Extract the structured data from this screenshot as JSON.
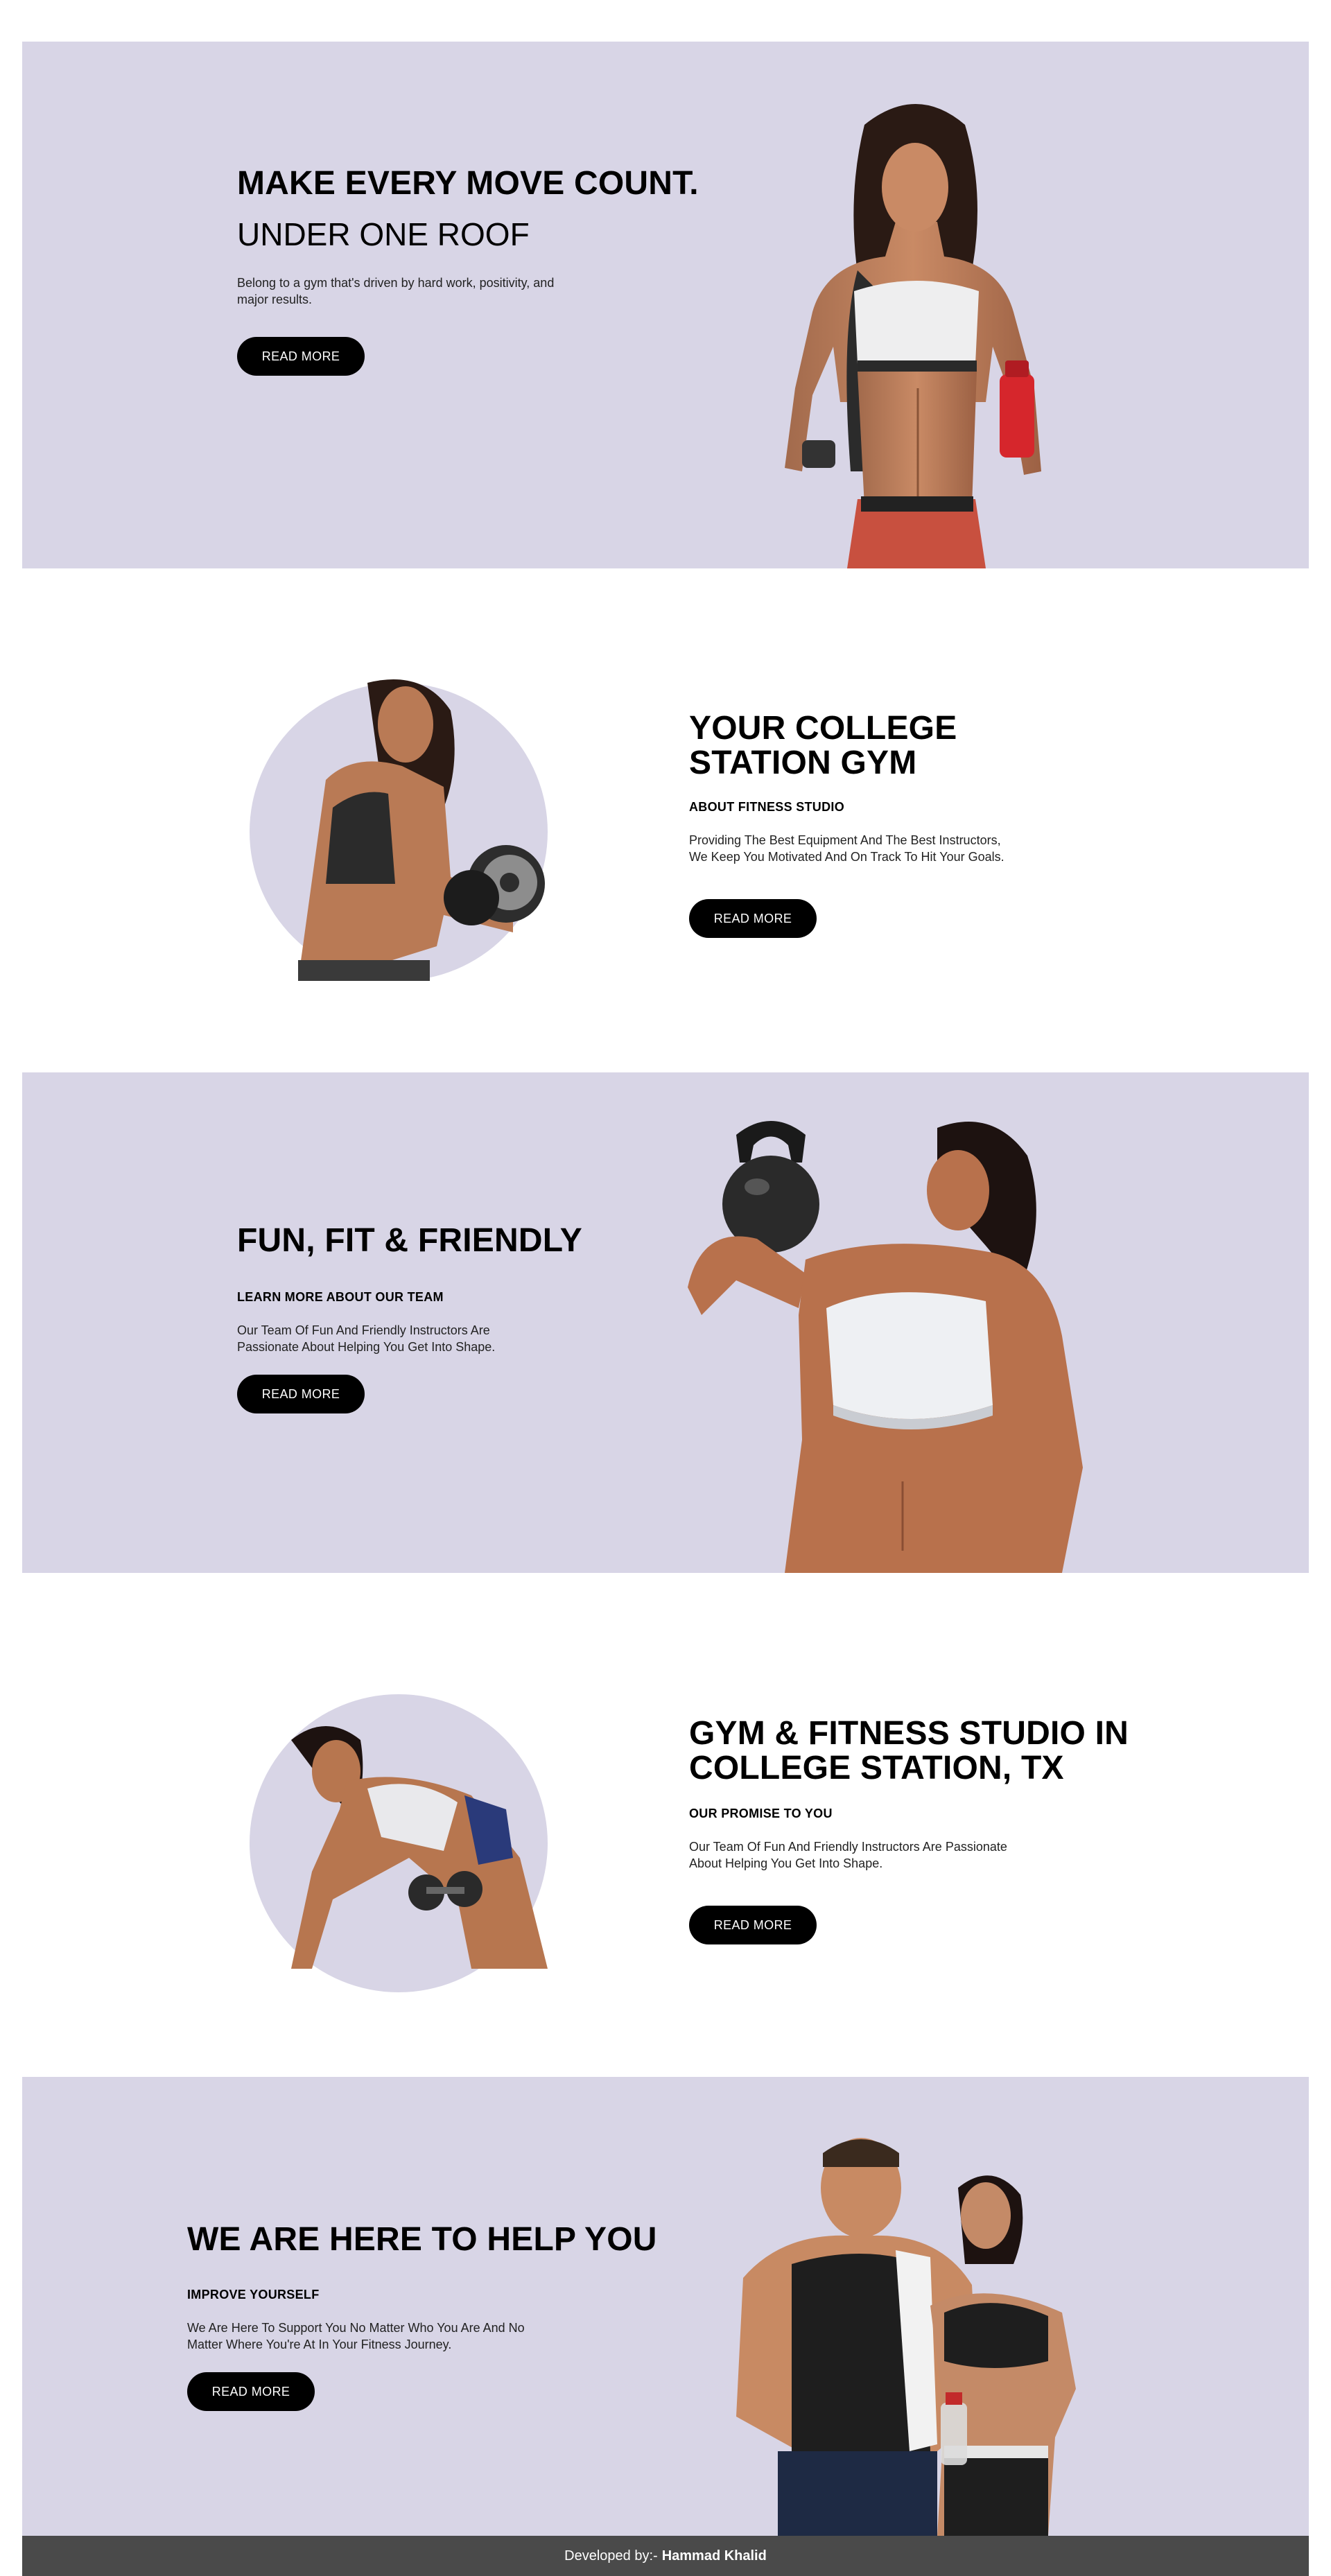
{
  "hero": {
    "title": "MAKE EVERY MOVE COUNT.",
    "subtitle": "UNDER ONE ROOF",
    "description_line1": "Belong to a gym that's driven by hard work, positivity, and",
    "description_line2": "major results.",
    "button": "READ MORE"
  },
  "about": {
    "title_line1": "YOUR COLLEGE",
    "title_line2": "STATION GYM",
    "kicker": "ABOUT FITNESS STUDIO",
    "text_line1": "Providing The Best Equipment And The Best Instructors,",
    "text_line2": "We Keep You Motivated And On Track To Hit Your Goals.",
    "button": "READ MORE"
  },
  "team": {
    "title": "FUN, FIT & FRIENDLY",
    "kicker": "LEARN MORE ABOUT OUR TEAM",
    "text_line1": "Our Team Of Fun And Friendly Instructors Are",
    "text_line2": "Passionate About Helping You Get Into Shape.",
    "button": "READ MORE"
  },
  "studio": {
    "title_line1": "GYM & FITNESS STUDIO IN",
    "title_line2": "COLLEGE STATION, TX",
    "kicker": "OUR PROMISE TO YOU",
    "text_line1": "Our Team Of Fun And Friendly Instructors Are Passionate",
    "text_line2": "About Helping You Get Into Shape.",
    "button": "READ MORE"
  },
  "help": {
    "title": "WE ARE HERE TO HELP YOU",
    "kicker": "IMPROVE YOURSELF",
    "text_line1": "We Are Here To Support You No Matter Who You Are And No",
    "text_line2": "Matter Where You're At In Your Fitness Journey.",
    "button": "READ MORE"
  },
  "footer": {
    "prefix": "Developed by:-",
    "author": "Hammad Khalid"
  },
  "colors": {
    "band": "#d8d5e6",
    "button": "#000000",
    "footer": "#4a4a4a"
  }
}
